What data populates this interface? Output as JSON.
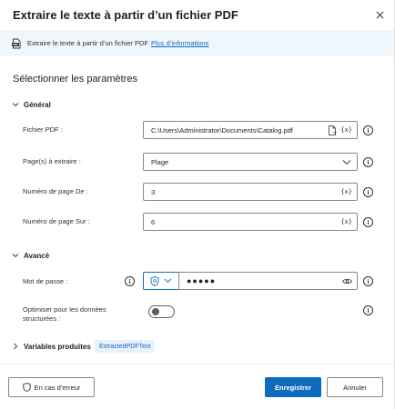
{
  "dialog": {
    "title": "Extraire le texte à partir d’un fichier PDF",
    "close_icon": "close-icon"
  },
  "banner": {
    "icon": "pdf-file-icon",
    "description": "Extraire le texte à partir d’un fichier PDF",
    "link": "Plus d’informations"
  },
  "section_title": "Sélectionner les paramètres",
  "general": {
    "header": "Général",
    "pdf_file": {
      "label": "Fichier PDF :",
      "value": "C:\\Users\\Administrator\\Documents\\Catalog.pdf",
      "var": "{x}"
    },
    "pages": {
      "label": "Page(s) à extraire :",
      "value": "Plage"
    },
    "page_from": {
      "label": "Numéro de page De :",
      "value": "3",
      "var": "{x}"
    },
    "page_to": {
      "label": "Numéro de page Sur :",
      "value": "6",
      "var": "{x}"
    }
  },
  "advanced": {
    "header": "Avancé",
    "password": {
      "label": "Mot de passe :",
      "value": "●●●●●"
    },
    "optimize": {
      "label_line1": "Optimiser pour les données",
      "label_line2": "structurées :",
      "enabled": false
    }
  },
  "variables": {
    "header": "Variables produites",
    "tag": "ExtractedPDFText"
  },
  "footer": {
    "on_error": "En cas d’erreur",
    "save": "Enregistrer",
    "cancel": "Annuler"
  },
  "info_glyph": "i",
  "colors": {
    "accent": "#0f6cbd",
    "banner_bg": "#eff6fc",
    "border": "#8a8886"
  }
}
